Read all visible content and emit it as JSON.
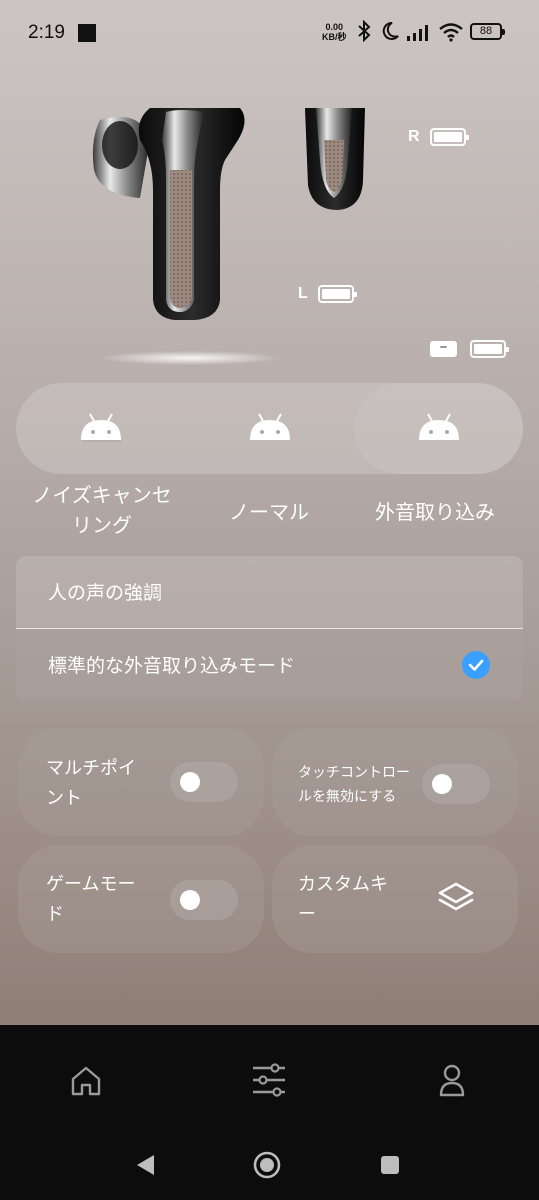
{
  "status_bar": {
    "time": "2:19",
    "net_speed_value": "0.00",
    "net_speed_unit": "KB/秒",
    "battery": "88",
    "icons": [
      "notification-square-icon",
      "bluetooth-icon",
      "do-not-disturb-moon-icon",
      "signal-bars-icon",
      "wifi-icon",
      "battery-icon"
    ]
  },
  "earbuds": {
    "right_label": "R",
    "left_label": "L",
    "right_battery": 1.0,
    "left_battery": 1.0,
    "case_battery": 1.0
  },
  "modes": {
    "items": [
      {
        "label_line1": "ノイズキャンセ",
        "label_line2": "リング",
        "icon": "android-icon"
      },
      {
        "label_line1": "ノーマル",
        "label_line2": "",
        "icon": "android-icon"
      },
      {
        "label_line1": "外音取り込み",
        "label_line2": "",
        "icon": "android-icon"
      }
    ],
    "selected": "外音取り込み"
  },
  "ambient_options": {
    "items": [
      {
        "label": "人の声の強調",
        "selected": false
      },
      {
        "label": "標準的な外音取り込みモード",
        "selected": true
      }
    ]
  },
  "tiles": {
    "multipoint": {
      "label_line1": "マルチポイ",
      "label_line2": "ント",
      "enabled": false
    },
    "touch_control": {
      "label_line1": "タッチコントロー",
      "label_line2": "ルを無効にする",
      "enabled": false
    },
    "game_mode": {
      "label_line1": "ゲームモー",
      "label_line2": "ド",
      "enabled": false
    },
    "custom_key": {
      "label_line1": "カスタムキ",
      "label_line2": "ー",
      "icon": "layers-icon"
    }
  },
  "bottom_nav": {
    "items": [
      "home-icon",
      "equalizer-sliders-icon",
      "profile-icon"
    ]
  },
  "system_nav": {
    "items": [
      "back-icon",
      "home-circle-icon",
      "recents-square-icon"
    ]
  },
  "colors": {
    "accent_check": "#3aa0ff",
    "nav_background": "#0c0c0c"
  }
}
